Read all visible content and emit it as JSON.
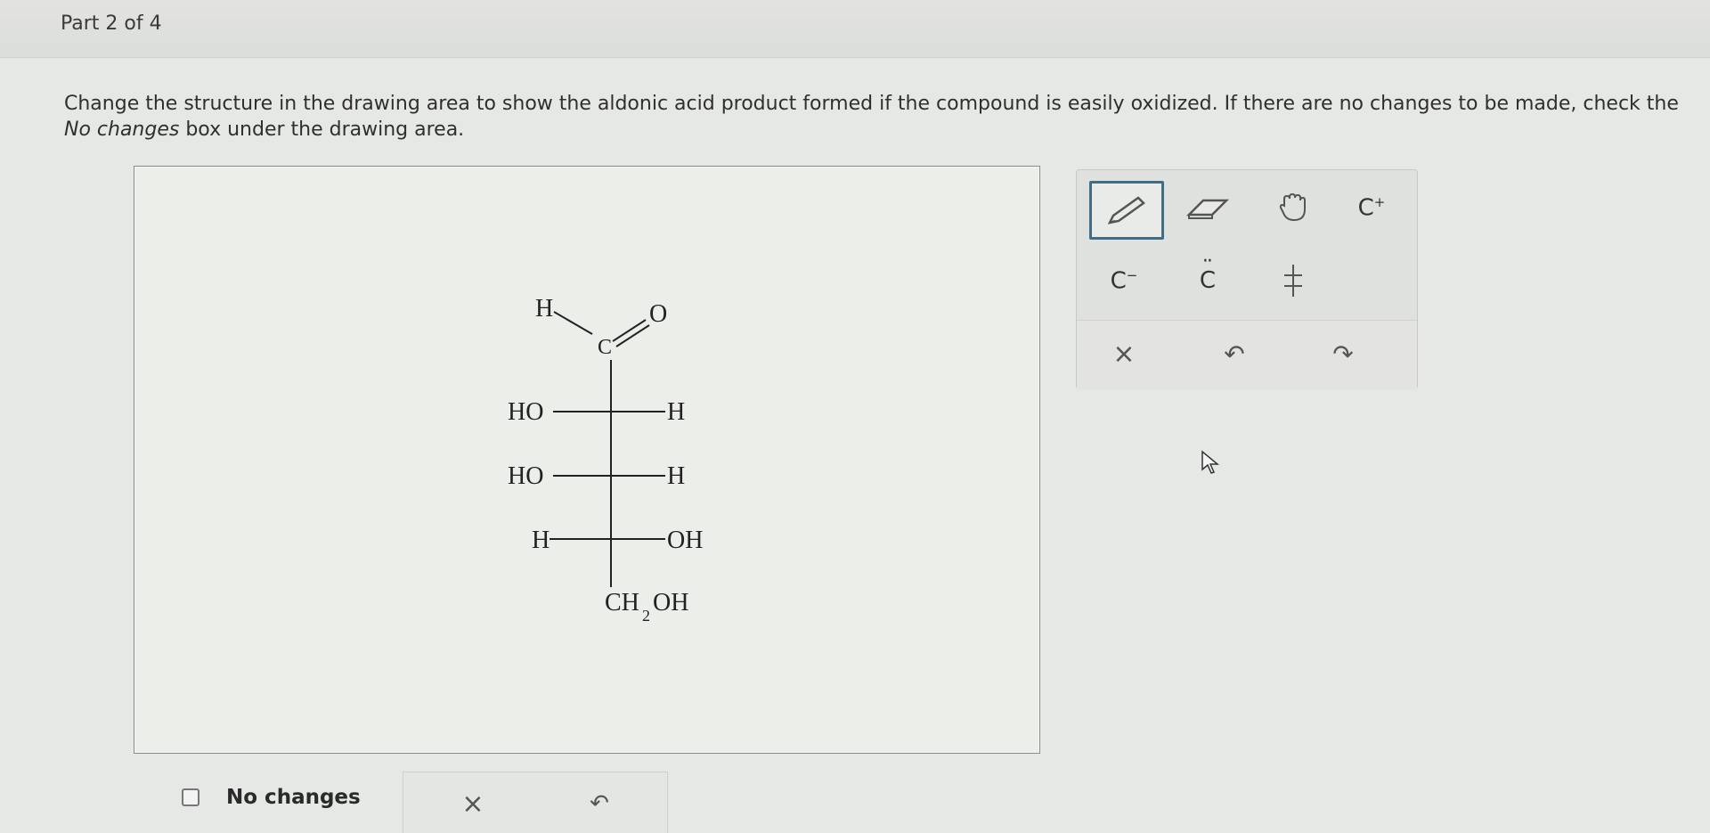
{
  "header": {
    "part_label": "Part 2 of 4"
  },
  "instructions": {
    "text_before": "Change the structure in the drawing area to show the aldonic acid product formed if the compound is easily oxidized. If there are no changes to be made, check the ",
    "emphasis": "No changes",
    "text_after": " box under the drawing area."
  },
  "molecule": {
    "top_h": "H",
    "carbonyl_c": "C",
    "carbonyl_o": "O",
    "rows": [
      {
        "left": "HO",
        "right": "H"
      },
      {
        "left": "HO",
        "right": "H"
      },
      {
        "left": "H",
        "right": "OH"
      }
    ],
    "bottom_main": "CH",
    "bottom_sub": "2",
    "bottom_end": "OH"
  },
  "toolbar": {
    "tools": [
      {
        "name": "pencil-icon"
      },
      {
        "name": "eraser-icon"
      },
      {
        "name": "hand-icon"
      },
      {
        "name": "carbocation-icon",
        "label": "C",
        "superscript": "+"
      },
      {
        "name": "carbanion-icon",
        "label": "C",
        "superscript": "−"
      },
      {
        "name": "lone-pair-icon",
        "label": "C",
        "dots": "··"
      },
      {
        "name": "ring-icon"
      },
      {
        "name": "clear-icon",
        "label": "×"
      },
      {
        "name": "undo-icon",
        "label": "↶"
      },
      {
        "name": "redo-icon",
        "label": "↷"
      }
    ]
  },
  "no_changes": {
    "label": "No changes"
  },
  "bottom_controls": {
    "clear_label": "×",
    "undo_label": "↶"
  }
}
